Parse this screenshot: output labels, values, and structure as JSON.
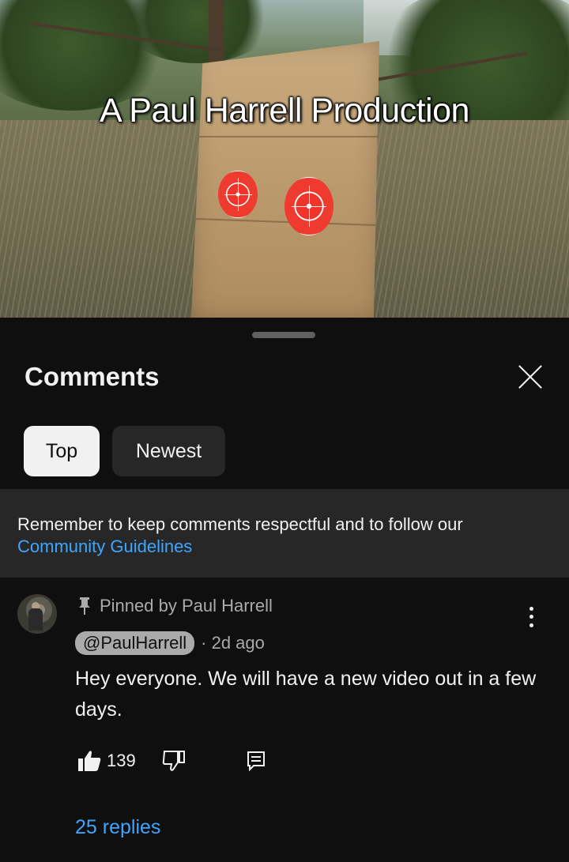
{
  "video": {
    "overlay_title": "A Paul Harrell Production"
  },
  "comments_panel": {
    "title": "Comments",
    "sort_chips": [
      {
        "label": "Top",
        "selected": true
      },
      {
        "label": "Newest",
        "selected": false
      }
    ],
    "notice": {
      "text": "Remember to keep comments respectful and to follow our",
      "link_text": "Community Guidelines"
    }
  },
  "comment": {
    "pinned_label": "Pinned by Paul Harrell",
    "author": "@PaulHarrell",
    "time": "· 2d ago",
    "text": "Hey everyone. We will have a new video out in a few days.",
    "like_count": "139",
    "replies_label": "25 replies"
  },
  "colors": {
    "background": "#0f0f0f",
    "surface": "#272727",
    "link": "#3ea6ff",
    "secondary_text": "#aaaaaa"
  },
  "icons": {
    "close": "close-icon",
    "pin": "pin-icon",
    "more": "more-vert-icon",
    "like": "thumbs-up-icon",
    "dislike": "thumbs-down-icon",
    "reply": "reply-comment-icon"
  }
}
